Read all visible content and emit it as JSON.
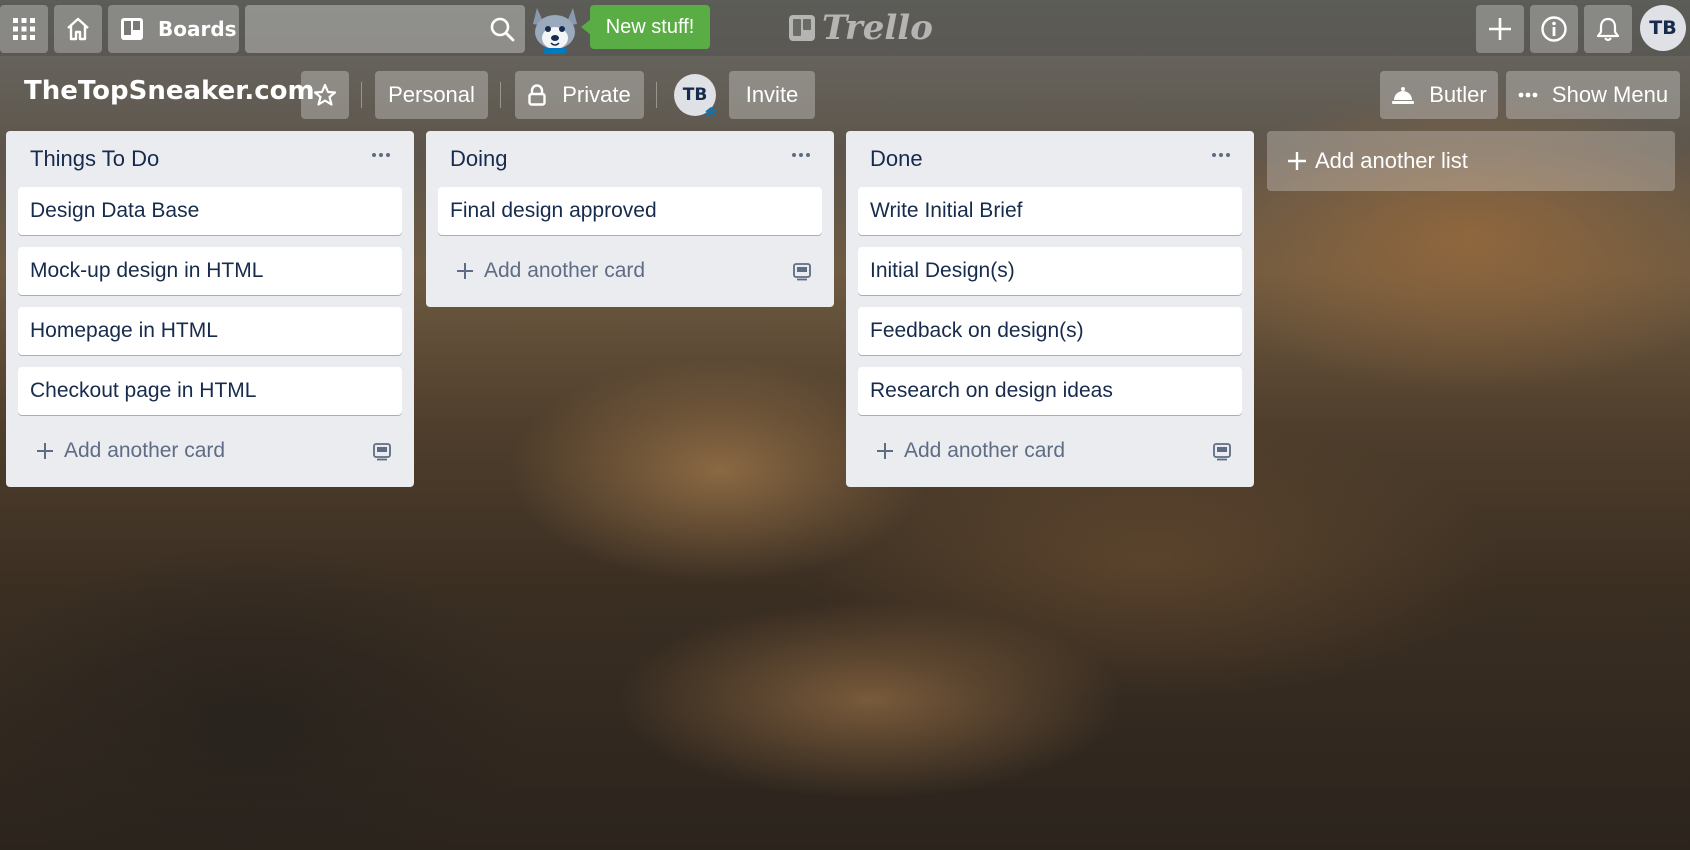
{
  "header": {
    "apps_icon": "grid-icon",
    "home_icon": "home-icon",
    "boards_label": "Boards",
    "search_placeholder": "",
    "new_stuff_label": "New stuff!",
    "logo_text": "Trello",
    "user_initials": "TB"
  },
  "board": {
    "title": "TheTopSneaker.com",
    "personal_label": "Personal",
    "private_label": "Private",
    "member_initials": "TB",
    "invite_label": "Invite",
    "butler_label": "Butler",
    "show_menu_label": "Show Menu"
  },
  "lists": [
    {
      "title": "Things To Do",
      "cards": [
        "Design Data Base",
        "Mock-up design in HTML",
        "Homepage in HTML",
        "Checkout page in HTML"
      ],
      "add_card_label": "Add another card"
    },
    {
      "title": "Doing",
      "cards": [
        "Final design approved"
      ],
      "add_card_label": "Add another card"
    },
    {
      "title": "Done",
      "cards": [
        "Write Initial Brief",
        "Initial Design(s)",
        "Feedback on design(s)",
        "Research on design ideas"
      ],
      "add_card_label": "Add another card"
    }
  ],
  "add_list_label": "Add another list",
  "colors": {
    "new_stuff_green": "#5aac44",
    "list_bg": "#ebecf0",
    "card_text": "#172b4d",
    "muted_text": "#5e6c84"
  }
}
